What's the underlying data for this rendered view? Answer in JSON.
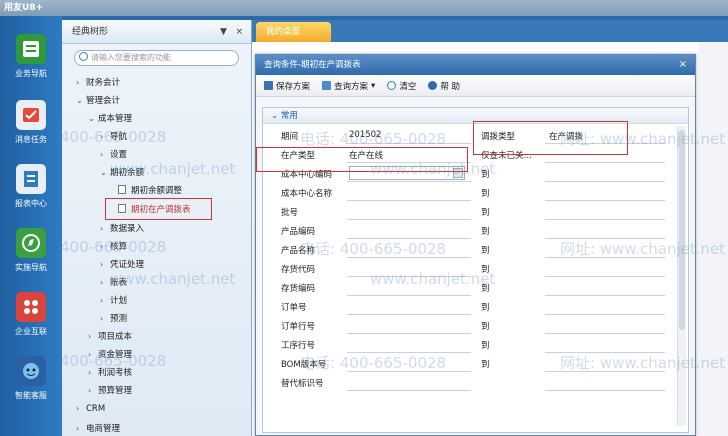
{
  "window": {
    "title": "用友U8+"
  },
  "left_nav": {
    "items": [
      {
        "label": "业务导航"
      },
      {
        "label": "消息任务"
      },
      {
        "label": "报表中心"
      },
      {
        "label": "实施导航"
      },
      {
        "label": "企业互联"
      },
      {
        "label": "智能客服"
      }
    ]
  },
  "tree": {
    "title": "经典树形",
    "pin": "▼",
    "close": "×",
    "search_placeholder": "请输入您要搜索的功能",
    "nodes": [
      {
        "label": "财务会计",
        "arrow": "›"
      },
      {
        "label": "管理会计",
        "arrow": "⌄"
      },
      {
        "label": "成本管理",
        "arrow": "⌄"
      },
      {
        "label": "导航",
        "arrow": "›"
      },
      {
        "label": "设置",
        "arrow": "›"
      },
      {
        "label": "期初余额",
        "arrow": "⌄"
      },
      {
        "label": "期初余额调整",
        "arrow": ""
      },
      {
        "label": "期初在产调拨表",
        "arrow": ""
      },
      {
        "label": "数据录入",
        "arrow": "›"
      },
      {
        "label": "核算",
        "arrow": "›"
      },
      {
        "label": "凭证处理",
        "arrow": "›"
      },
      {
        "label": "账表",
        "arrow": "›"
      },
      {
        "label": "计划",
        "arrow": "›"
      },
      {
        "label": "预测",
        "arrow": "›"
      },
      {
        "label": "项目成本",
        "arrow": "›"
      },
      {
        "label": "资金管理",
        "arrow": "›"
      },
      {
        "label": "利润考核",
        "arrow": "›"
      },
      {
        "label": "预算管理",
        "arrow": "›"
      },
      {
        "label": "CRM",
        "arrow": "›"
      },
      {
        "label": "电商管理",
        "arrow": "›"
      }
    ]
  },
  "tabs": {
    "active": "我的桌面"
  },
  "dialog": {
    "title": "查询条件-期初在产调拨表",
    "close": "×",
    "toolbar": {
      "save_scheme": "保存方案",
      "query_scheme": "查询方案",
      "query_arrow": "▾",
      "clear": "清空",
      "help": "帮 助"
    },
    "section": "常用",
    "fields": [
      {
        "label": "期间",
        "value": "201502",
        "to": "调拨类型",
        "right": "在产调拨"
      },
      {
        "label": "在产类型",
        "value": "在产在线",
        "to": "仅查未已关…",
        "right": ""
      },
      {
        "label": "成本中心编码",
        "value": "",
        "to": "到",
        "right": ""
      },
      {
        "label": "成本中心名称",
        "value": "",
        "to": "到",
        "right": ""
      },
      {
        "label": "批号",
        "value": "",
        "to": "到",
        "right": ""
      },
      {
        "label": "产品编码",
        "value": "",
        "to": "到",
        "right": ""
      },
      {
        "label": "产品名称",
        "value": "",
        "to": "到",
        "right": ""
      },
      {
        "label": "存货代码",
        "value": "",
        "to": "到",
        "right": ""
      },
      {
        "label": "存货编码",
        "value": "",
        "to": "到",
        "right": ""
      },
      {
        "label": "订单号",
        "value": "",
        "to": "到",
        "right": ""
      },
      {
        "label": "订单行号",
        "value": "",
        "to": "到",
        "right": ""
      },
      {
        "label": "工序行号",
        "value": "",
        "to": "到",
        "right": ""
      },
      {
        "label": "BOM版本号",
        "value": "",
        "to": "到",
        "right": ""
      },
      {
        "label": "替代标识号",
        "value": "",
        "to": "",
        "right": ""
      }
    ]
  },
  "watermark": {
    "phone": "电话: 400-665-0028",
    "site": "网址: www.chanjet.net",
    "phone_short": "400-665-0028",
    "site_short": "www.chanjet.net"
  }
}
